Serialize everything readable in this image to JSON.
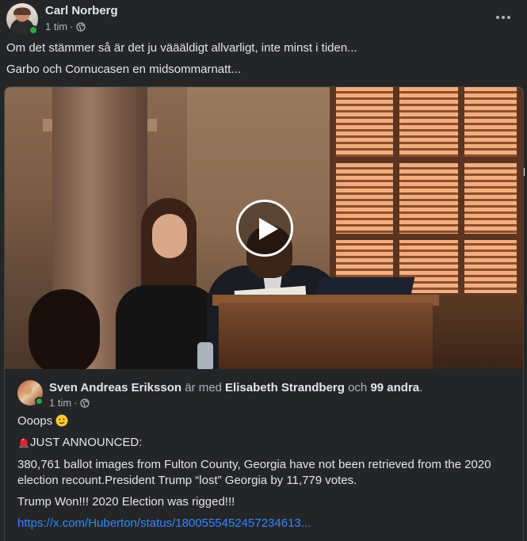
{
  "post": {
    "author": "Carl Norberg",
    "time": "1 tim",
    "separator": "·",
    "lines": [
      "Om det stämmer så är det ju väääldigt allvarligt, inte minst i tiden...",
      "Garbo och Cornucasen en midsommarnatt..."
    ],
    "more_icon": "more-dots-icon",
    "audience_icon": "globe-icon"
  },
  "shared": {
    "author": "Sven Andreas Eriksson",
    "with_text": "är med",
    "tagged": "Elisabeth Strandberg",
    "and_text": "och",
    "others": "99 andra",
    "period": ".",
    "time": "1 tim",
    "separator": "·",
    "line1": "Ooops",
    "line2": "JUST ANNOUNCED:",
    "line3": "380,761 ballot images from Fulton County, Georgia have not been retrieved from the 2020 election recount.President Trump “lost” Georgia by 11,779 votes.",
    "line4": "Trump Won!!! 2020 Election was rigged!!!",
    "link": "https://x.com/Huberton/status/1800555452457234613..."
  },
  "colors": {
    "background": "#242526",
    "text": "#e4e6eb",
    "secondary": "#b0b3b8",
    "link": "#2e89ff",
    "online": "#31a24c"
  }
}
